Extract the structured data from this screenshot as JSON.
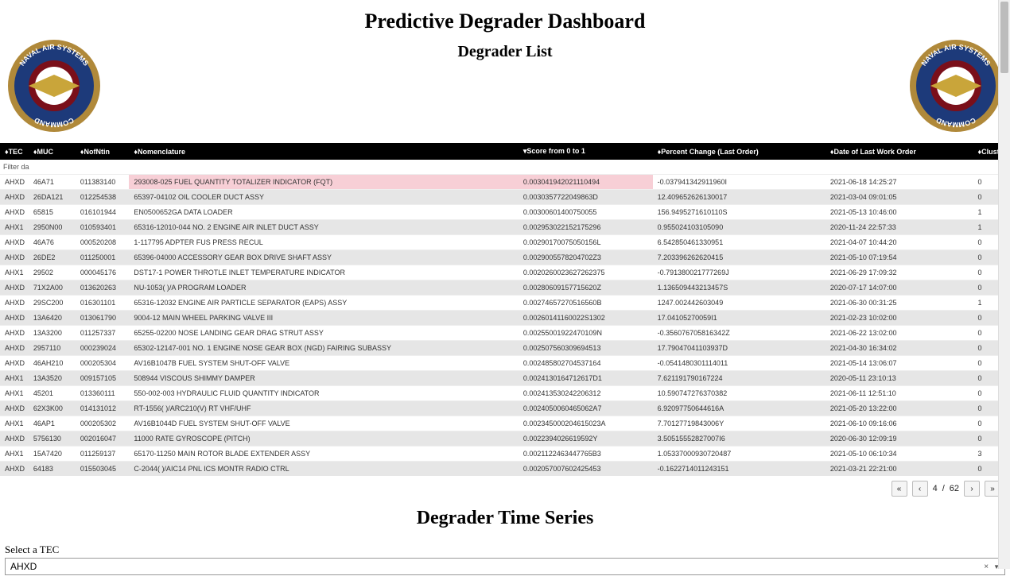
{
  "header": {
    "title": "Predictive Degrader Dashboard",
    "subtitle": "Degrader List",
    "seal_text_top": "NAVAL AIR SYSTEMS",
    "seal_text_bottom": "COMMAND"
  },
  "columns": {
    "tec": "♦TEC",
    "muc": "♦MUC",
    "nofntin": "♦NofNtin",
    "nomenclature": "♦Nomenclature",
    "score": "▾Score from 0 to 1",
    "pct_change": "♦Percent Change (Last Order)",
    "last_date": "♦Date of Last Work Order",
    "cluster": "♦Cluster"
  },
  "filter_hint": "Filter da",
  "rows": [
    {
      "tec": "AHXD",
      "muc": "46A71",
      "nofn": "011383140",
      "nom": "293008-025 FUEL QUANTITY TOTALIZER INDICATOR (FQT)",
      "score": "0.003041942021110494",
      "pct": "-0.037941342911960I",
      "date": "2021-06-18 14:25:27",
      "cluster": "0",
      "hl": true
    },
    {
      "tec": "AHXD",
      "muc": "26DA121",
      "nofn": "012254538",
      "nom": "65397-04102 OIL COOLER DUCT ASSY",
      "score": "0.0030357722049863D",
      "pct": "12.409652626130017",
      "date": "2021-03-04 09:01:05",
      "cluster": "0"
    },
    {
      "tec": "AHXD",
      "muc": "65815",
      "nofn": "016101944",
      "nom": "EN0500652GA DATA LOADER",
      "score": "0.00300601400750055",
      "pct": "156.9495271610110S",
      "date": "2021-05-13 10:46:00",
      "cluster": "1"
    },
    {
      "tec": "AHX1",
      "muc": "2950N00",
      "nofn": "010593401",
      "nom": "65316-12010-044 NO. 2 ENGINE AIR INLET DUCT ASSY",
      "score": "0.002953022152175296",
      "pct": "0.955024103105090",
      "date": "2020-11-24 22:57:33",
      "cluster": "1"
    },
    {
      "tec": "AHXD",
      "muc": "46A76",
      "nofn": "000520208",
      "nom": "1-117795 ADPTER FUS PRESS RECUL",
      "score": "0.00290170075050156L",
      "pct": "6.542850461330951",
      "date": "2021-04-07 10:44:20",
      "cluster": "0"
    },
    {
      "tec": "AHXD",
      "muc": "26DE2",
      "nofn": "011250001",
      "nom": "65396-04000 ACCESSORY GEAR BOX DRIVE SHAFT ASSY",
      "score": "0.0029005578204702Z3",
      "pct": "7.203396262620415",
      "date": "2021-05-10 07:19:54",
      "cluster": "0"
    },
    {
      "tec": "AHX1",
      "muc": "29502",
      "nofn": "000045176",
      "nom": "DST17-1 POWER THROTLE INLET TEMPERATURE INDICATOR",
      "score": "0.0020260023627262375",
      "pct": "-0.791380021777269J",
      "date": "2021-06-29 17:09:32",
      "cluster": "0"
    },
    {
      "tec": "AHXD",
      "muc": "71X2A00",
      "nofn": "013620263",
      "nom": "NU-1053( )/A PROGRAM LOADER",
      "score": "0.00280609157715620Z",
      "pct": "1.136509443213457S",
      "date": "2020-07-17 14:07:00",
      "cluster": "0"
    },
    {
      "tec": "AHXD",
      "muc": "29SC200",
      "nofn": "016301101",
      "nom": "65316-12032 ENGINE AIR PARTICLE SEPARATOR (EAPS) ASSY",
      "score": "0.00274657270516560B",
      "pct": "1247.002442603049",
      "date": "2021-06-30 00:31:25",
      "cluster": "1"
    },
    {
      "tec": "AHXD",
      "muc": "13A6420",
      "nofn": "013061790",
      "nom": "9004-12 MAIN WHEEL PARKING VALVE III",
      "score": "0.00260141160022S1302",
      "pct": "17.04105270059I1",
      "date": "2021-02-23 10:02:00",
      "cluster": "0"
    },
    {
      "tec": "AHXD",
      "muc": "13A3200",
      "nofn": "011257337",
      "nom": "65255-02200 NOSE LANDING GEAR DRAG STRUT ASSY",
      "score": "0.00255001922470109N",
      "pct": "-0.356076705816342Z",
      "date": "2021-06-22 13:02:00",
      "cluster": "0"
    },
    {
      "tec": "AHXD",
      "muc": "2957110",
      "nofn": "000239024",
      "nom": "65302-12147-001 NO. 1 ENGINE NOSE GEAR BOX (NGD) FAIRING SUBASSY",
      "score": "0.002507560309694513",
      "pct": "17.79047041103937D",
      "date": "2021-04-30 16:34:02",
      "cluster": "0"
    },
    {
      "tec": "AHXD",
      "muc": "46AH210",
      "nofn": "000205304",
      "nom": "AV16B1047B FUEL SYSTEM SHUT-OFF VALVE",
      "score": "0.002485802704537164",
      "pct": "-0.0541480301114011",
      "date": "2021-05-14 13:06:07",
      "cluster": "0"
    },
    {
      "tec": "AHX1",
      "muc": "13A3520",
      "nofn": "009157105",
      "nom": "508944 VISCOUS SHIMMY DAMPER",
      "score": "0.0024130164712617D1",
      "pct": "7.621191790167224",
      "date": "2020-05-11 23:10:13",
      "cluster": "0"
    },
    {
      "tec": "AHX1",
      "muc": "45201",
      "nofn": "013360111",
      "nom": "550-002-003 HYDRAULIC FLUID QUANTITY INDICATOR",
      "score": "0.002413530242206312",
      "pct": "10.590747276370382",
      "date": "2021-06-11 12:51:10",
      "cluster": "0"
    },
    {
      "tec": "AHXD",
      "muc": "62X3K00",
      "nofn": "014131012",
      "nom": "RT-1556( )/ARC210(V) RT VHF/UHF",
      "score": "0.0024050060465062A7",
      "pct": "6.92097750644616A",
      "date": "2021-05-20 13:22:00",
      "cluster": "0"
    },
    {
      "tec": "AHX1",
      "muc": "46AP1",
      "nofn": "000205302",
      "nom": "AV16B1044D FUEL SYSTEM SHUT-OFF VALVE",
      "score": "0.002345000204615023A",
      "pct": "7.70127719843006Y",
      "date": "2021-06-10 09:16:06",
      "cluster": "0"
    },
    {
      "tec": "AHXD",
      "muc": "5756130",
      "nofn": "002016047",
      "nom": "11000 RATE GYROSCOPE (PITCH)",
      "score": "0.0022394026619592Y",
      "pct": "3.50515552827007I6",
      "date": "2020-06-30 12:09:19",
      "cluster": "0"
    },
    {
      "tec": "AHX1",
      "muc": "15A7420",
      "nofn": "011259137",
      "nom": "65170-11250 MAIN ROTOR BLADE EXTENDER ASSY",
      "score": "0.0021122463447765B3",
      "pct": "1.05337000930720487",
      "date": "2021-05-10 06:10:34",
      "cluster": "3"
    },
    {
      "tec": "AHXD",
      "muc": "64183",
      "nofn": "015503045",
      "nom": "C-2044( )/AIC14 PNL ICS MONTR RADIO CTRL",
      "score": "0.002057007602425453",
      "pct": "-0.1622714011243151",
      "date": "2021-03-21 22:21:00",
      "cluster": "0"
    }
  ],
  "pagination": {
    "first": "«",
    "prev": "‹",
    "page": "4",
    "sep": "/",
    "total": "62",
    "next": "›",
    "last": "»"
  },
  "timeseries": {
    "title": "Degrader Time Series",
    "select_label": "Select a TEC",
    "select_value": "AHXD"
  }
}
